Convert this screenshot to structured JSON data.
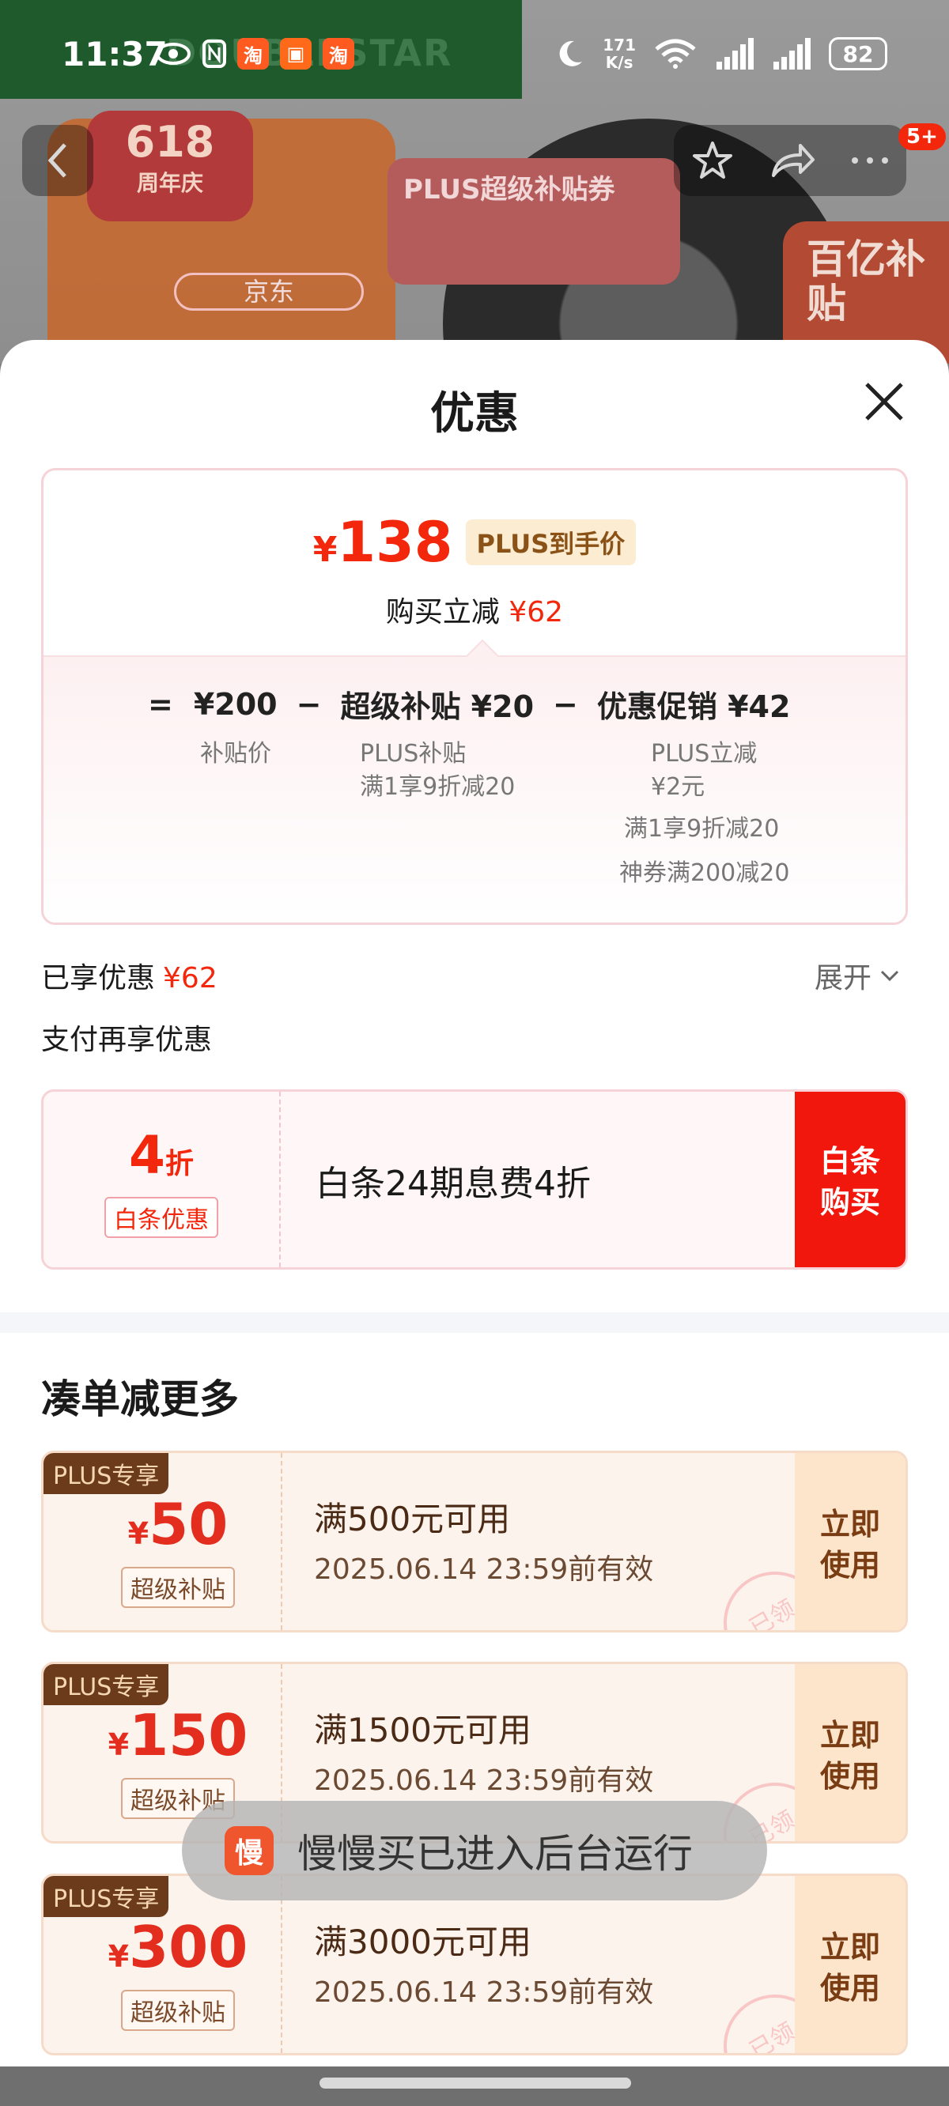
{
  "status_bar": {
    "time": "11:37",
    "net_speed_value": "171",
    "net_speed_unit": "K/s",
    "battery": "82"
  },
  "background": {
    "brand": "DOUBLESTAR",
    "badge_618": "618",
    "badge_618_sub": "周年庆",
    "plus_card": "PLUS超级补贴券",
    "subsidy": "百亿补贴",
    "jd": "京东"
  },
  "nav": {
    "badge": "5+"
  },
  "sheet": {
    "title": "优惠",
    "price": {
      "symbol": "¥",
      "amount": "138",
      "tag": "PLUS到手价",
      "sub_label": "购买立减",
      "sub_value": "¥62"
    },
    "formula": {
      "eq": "=",
      "base": "¥200",
      "minus1": "−",
      "item1": "超级补贴 ¥20",
      "minus2": "−",
      "item2": "优惠促销 ¥42",
      "base_note": "补贴价",
      "item1_note1": "PLUS补贴",
      "item1_note2": "满1享9折减20",
      "item2_note1": "PLUS立减",
      "item2_note2": "¥2元",
      "item2_note3": "满1享9折减20",
      "item2_note4": "神券满200减20"
    },
    "enjoyed_label": "已享优惠",
    "enjoyed_value": "¥62",
    "expand_label": "展开",
    "pay_more_label": "支付再享优惠",
    "baitiao": {
      "discount": "4",
      "discount_unit": "折",
      "tag": "白条优惠",
      "text": "白条24期息费4折",
      "btn_line1": "白条",
      "btn_line2": "购买"
    },
    "section_title": "凑单减更多",
    "coupons": [
      {
        "plus": "PLUS专享",
        "symbol": "¥",
        "amount": "50",
        "tag": "超级补贴",
        "cond": "满500元可用",
        "expire": "2025.06.14 23:59前有效",
        "btn1": "立即",
        "btn2": "使用",
        "stamp": "已领"
      },
      {
        "plus": "PLUS专享",
        "symbol": "¥",
        "amount": "150",
        "tag": "超级补贴",
        "cond": "满1500元可用",
        "expire": "2025.06.14 23:59前有效",
        "btn1": "立即",
        "btn2": "使用",
        "stamp": "已领"
      },
      {
        "plus": "PLUS专享",
        "symbol": "¥",
        "amount": "300",
        "tag": "超级补贴",
        "cond": "满3000元可用",
        "expire": "2025.06.14 23:59前有效",
        "btn1": "立即",
        "btn2": "使用",
        "stamp": "已领"
      }
    ]
  },
  "toast": {
    "icon": "慢",
    "text": "慢慢买已进入后台运行"
  },
  "colors": {
    "accent_red": "#f2270c",
    "plus_brown": "#6b3b1c",
    "coupon_bg": "#fdf3ed"
  }
}
